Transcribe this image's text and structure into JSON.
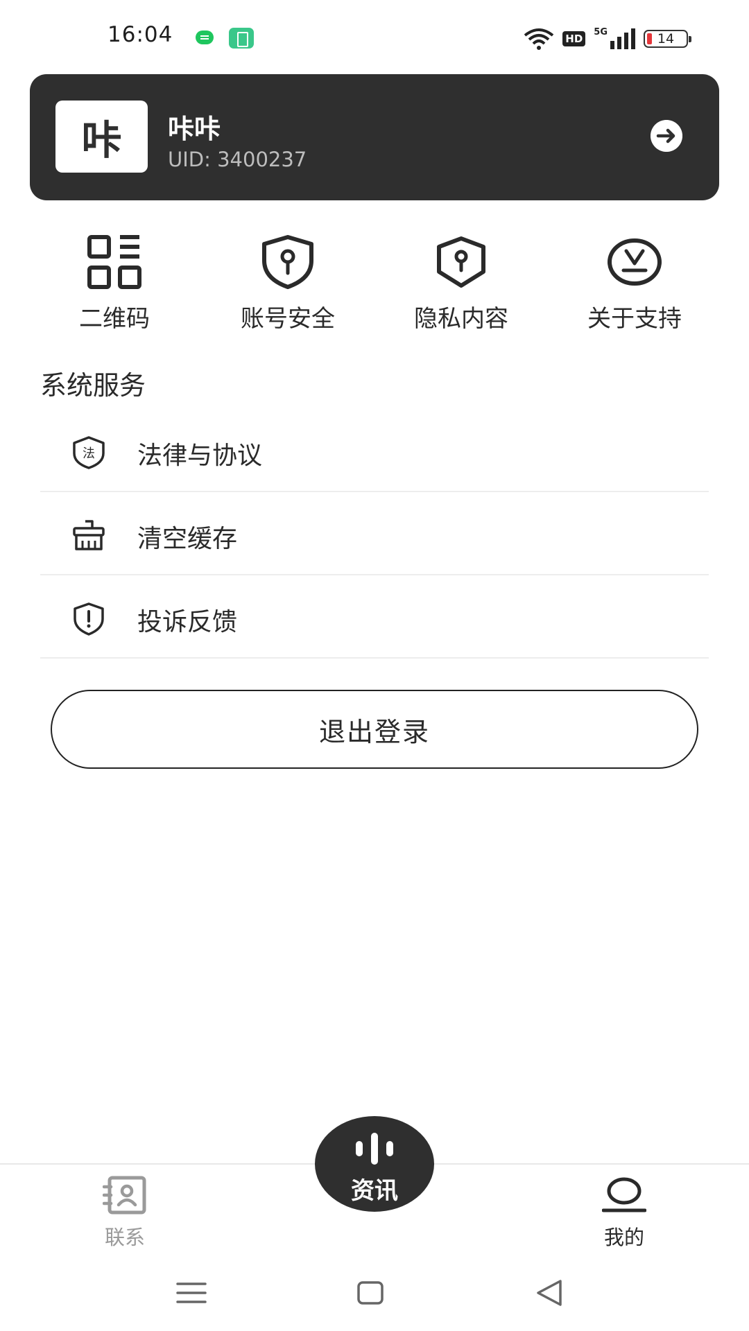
{
  "status_bar": {
    "time": "16:04",
    "network": "5G",
    "hd": "HD",
    "battery": "14",
    "icons": [
      "message-notification-icon",
      "battery-saver-icon",
      "wifi-icon",
      "signal-icon",
      "battery-icon"
    ]
  },
  "profile": {
    "avatar_text": "咔",
    "name": "咔咔",
    "uid": "UID: 3400237",
    "arrow_icon": "arrow-right-circle-icon"
  },
  "quick_actions": [
    {
      "label": "二维码",
      "icon": "qr-code-icon"
    },
    {
      "label": "账号安全",
      "icon": "shield-key-icon"
    },
    {
      "label": "隐私内容",
      "icon": "privacy-shield-icon"
    },
    {
      "label": "关于支持",
      "icon": "support-circle-icon"
    }
  ],
  "system_services": {
    "title": "系统服务",
    "items": [
      {
        "label": "法律与协议",
        "icon": "law-shield-icon",
        "icon_text": "法"
      },
      {
        "label": "清空缓存",
        "icon": "clean-basket-icon"
      },
      {
        "label": "投诉反馈",
        "icon": "alert-shield-icon"
      }
    ]
  },
  "logout_label": "退出登录",
  "bottom_nav": {
    "contacts": {
      "label": "联系",
      "icon": "contact-card-icon"
    },
    "news": {
      "label": "资讯",
      "icon": "voice-bars-icon"
    },
    "mine": {
      "label": "我的",
      "icon": "profile-icon"
    }
  },
  "colors": {
    "card_bg": "#2f2f2f",
    "text": "#2a2a2a",
    "inactive": "#9a9a9a",
    "battery_low": "#e5363a",
    "notif_green": "#1fc65e"
  }
}
